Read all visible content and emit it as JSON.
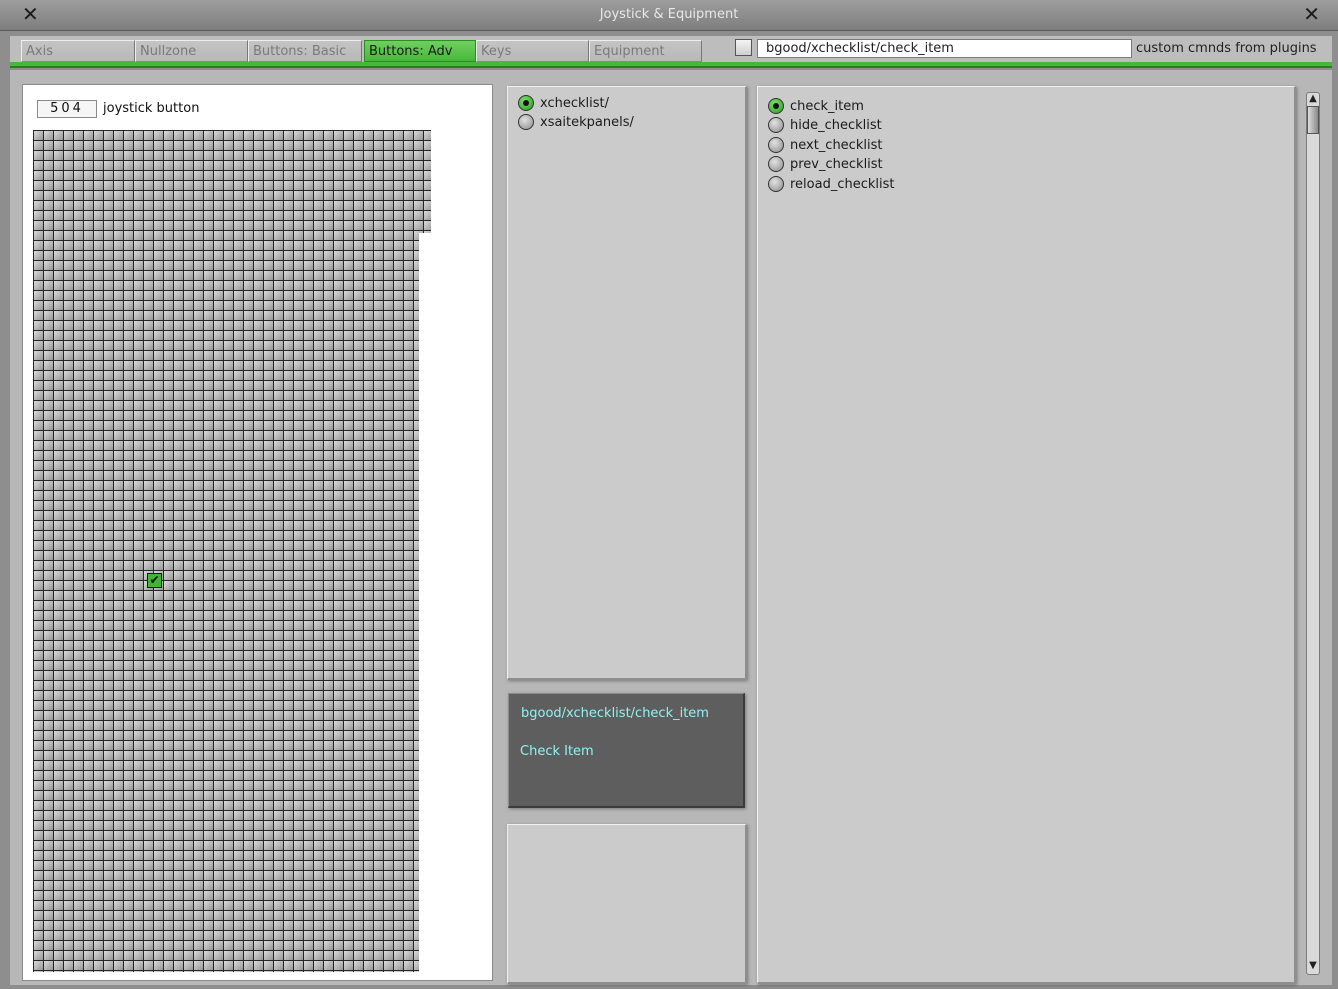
{
  "window": {
    "title": "Joystick & Equipment",
    "close_glyph": "✕"
  },
  "tabs": [
    {
      "label": "Axis",
      "active": false
    },
    {
      "label": "Nullzone",
      "active": false
    },
    {
      "label": "Buttons: Basic",
      "active": false
    },
    {
      "label": "Buttons: Adv",
      "active": true
    },
    {
      "label": "Keys",
      "active": false
    },
    {
      "label": "Equipment",
      "active": false
    }
  ],
  "command_bar": {
    "command_value": "bgood/xchecklist/check_item",
    "plugin_label": "custom cmnds from plugins",
    "checkbox_checked": false
  },
  "joystick": {
    "button_number": "504",
    "button_label": "joystick button",
    "checked_glyph": "✔"
  },
  "folders": [
    {
      "label": "xchecklist/",
      "selected": true
    },
    {
      "label": "xsaitekpanels/",
      "selected": false
    }
  ],
  "commands": [
    {
      "label": "check_item",
      "selected": true
    },
    {
      "label": "hide_checklist",
      "selected": false
    },
    {
      "label": "next_checklist",
      "selected": false
    },
    {
      "label": "prev_checklist",
      "selected": false
    },
    {
      "label": "reload_checklist",
      "selected": false
    }
  ],
  "info": {
    "path": "bgood/xchecklist/check_item",
    "description": "Check Item"
  },
  "colors": {
    "accent": "#46b839",
    "info_text": "#8ff2f2"
  }
}
